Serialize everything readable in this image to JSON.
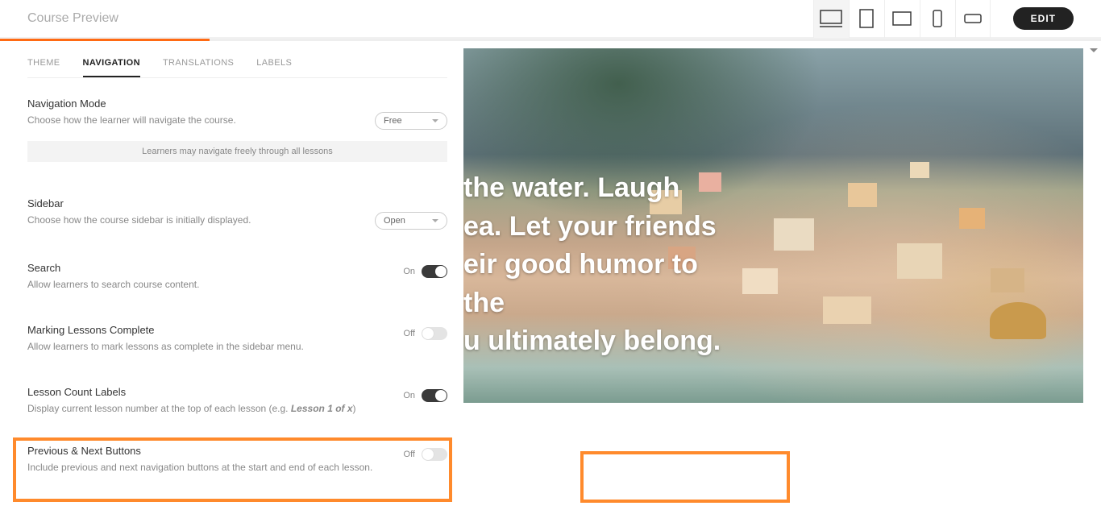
{
  "header": {
    "title": "Course Preview",
    "edit": "EDIT"
  },
  "tabs": {
    "theme": "THEME",
    "navigation": "NAVIGATION",
    "translations": "TRANSLATIONS",
    "labels": "LABELS"
  },
  "settings": {
    "navmode": {
      "title": "Navigation Mode",
      "desc": "Choose how the learner will navigate the course.",
      "value": "Free",
      "info": "Learners may navigate freely through all lessons"
    },
    "sidebar": {
      "title": "Sidebar",
      "desc": "Choose how the course sidebar is initially displayed.",
      "value": "Open"
    },
    "search": {
      "title": "Search",
      "desc": "Allow learners to search course content.",
      "state": "On"
    },
    "marking": {
      "title": "Marking Lessons Complete",
      "desc": "Allow learners to mark lessons as complete in the sidebar menu.",
      "state": "Off"
    },
    "count": {
      "title": "Lesson Count Labels",
      "desc_pre": "Display current lesson number at the top of each lesson (e.g. ",
      "desc_em": "Lesson 1 of x",
      "desc_post": ")",
      "state": "On"
    },
    "prevnext": {
      "title": "Previous & Next Buttons",
      "desc": "Include previous and next navigation buttons at the start and end of each lesson.",
      "state": "Off"
    }
  },
  "preview": {
    "text_line1": "the water. Laugh",
    "text_line2": "ea. Let your friends",
    "text_line3": "eir good humor to the",
    "text_line4": "u ultimately belong."
  }
}
